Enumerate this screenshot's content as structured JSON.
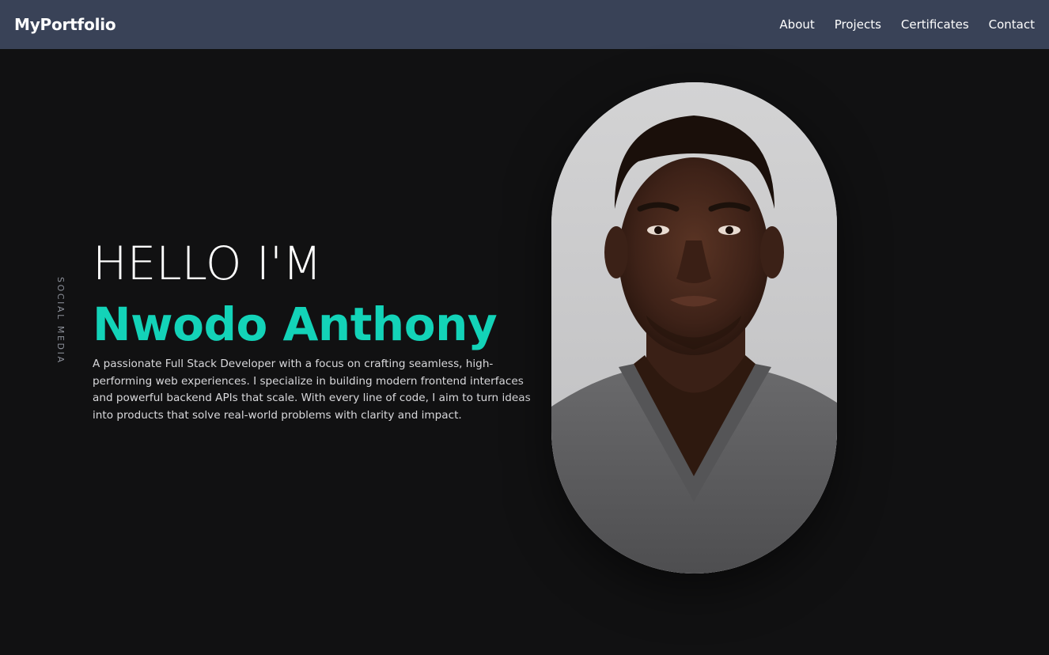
{
  "nav": {
    "brand": "MyPortfolio",
    "links": [
      "About",
      "Projects",
      "Certificates",
      "Contact"
    ]
  },
  "side": {
    "social_label": "SOCIAL MEDIA"
  },
  "hero": {
    "greeting": "HELLO I'M",
    "name": "Nwodo Anthony",
    "bio": "A passionate Full Stack Developer with a focus on crafting seamless, high-performing web experiences. I specialize in building modern frontend interfaces and powerful backend APIs that scale. With every line of code, I aim to turn ideas into products that solve real-world problems with clarity and impact."
  },
  "colors": {
    "navbar_bg": "#394257",
    "page_bg": "#111112",
    "accent": "#13d3b8"
  },
  "portrait": {
    "icon": "person-portrait-photo"
  }
}
